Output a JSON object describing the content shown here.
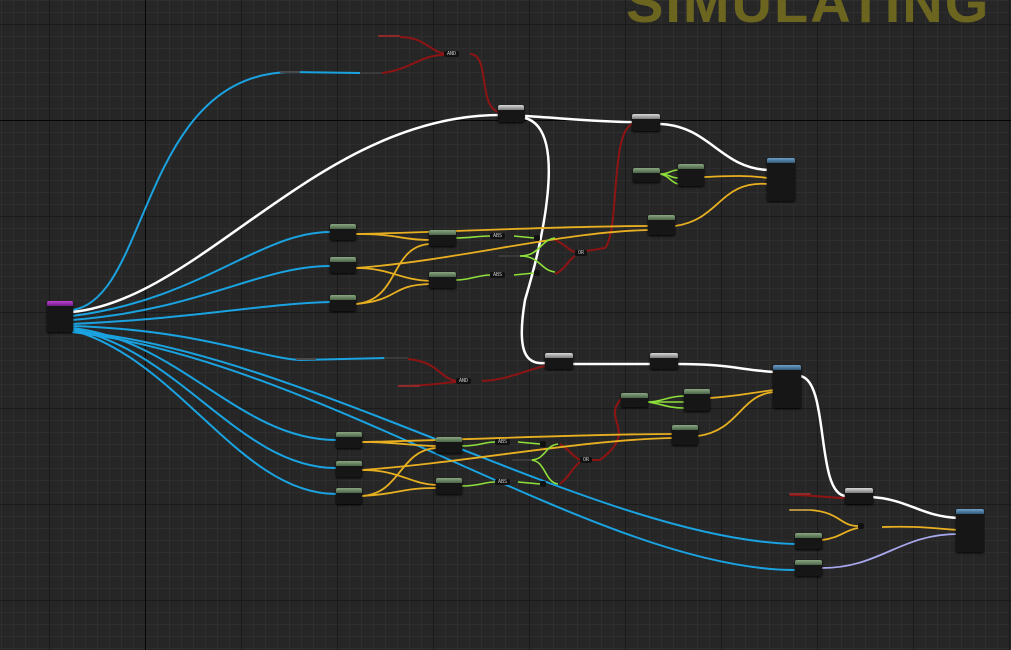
{
  "window_title": "",
  "watermark": "SIMULATING",
  "colors": {
    "background": "#262626",
    "exec_wire": "#ffffff",
    "object_wire": "#1aa3e0",
    "float_wire": "#e8b020",
    "vector_wire": "#8ee03a",
    "bool_wire": "#8e1414",
    "lilac_wire": "#a8a8ee",
    "watermark": "#6b6520"
  },
  "nodes": [
    {
      "id": "event-node",
      "kind": "purple",
      "icon": "event-node-icon"
    },
    {
      "id": "branch-top-1",
      "kind": "gray"
    },
    {
      "id": "branch-top-2",
      "kind": "gray"
    },
    {
      "id": "set-top",
      "kind": "blue"
    },
    {
      "id": "branch-bottom-1",
      "kind": "gray"
    },
    {
      "id": "branch-bottom-2",
      "kind": "gray"
    },
    {
      "id": "set-bottom",
      "kind": "blue"
    },
    {
      "id": "branch-final",
      "kind": "gray"
    },
    {
      "id": "set-final",
      "kind": "blue"
    }
  ],
  "operators": {
    "and_top": "AND",
    "and_bottom": "AND",
    "or_top": "OR",
    "or_bottom": "OR",
    "abs_labels": [
      "ABS",
      "ABS",
      "ABS",
      "ABS"
    ],
    "small_equal": "=="
  }
}
